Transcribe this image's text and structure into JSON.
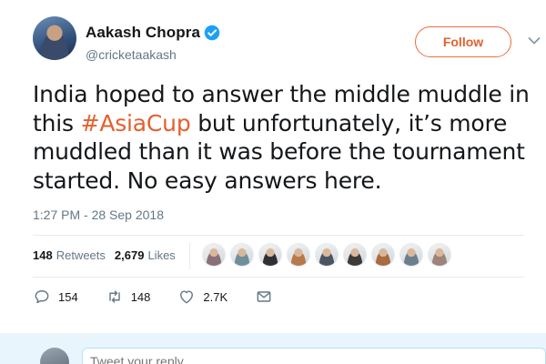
{
  "author": {
    "name": "Aakash Chopra",
    "handle": "@cricketaakash",
    "verified": true
  },
  "follow_label": "Follow",
  "tweet": {
    "lines": [
      [
        "India hoped to answer the middle muddle in"
      ],
      [
        "this ",
        "#AsiaCup",
        " but unfortunately, it’s more"
      ],
      [
        "muddled than it was before the tournament"
      ],
      [
        "started. No easy answers here."
      ]
    ],
    "hashtag": "#AsiaCup",
    "timestamp": "1:27 PM - 28 Sep 2018"
  },
  "stats": {
    "retweets_count": "148",
    "retweets_label": "Retweets",
    "likes_count": "2,679",
    "likes_label": "Likes"
  },
  "likers": [
    {
      "color": "#8a6f78"
    },
    {
      "color": "#6f8f9a"
    },
    {
      "color": "#2f2f34"
    },
    {
      "color": "#b87a4a"
    },
    {
      "color": "#4a5563"
    },
    {
      "color": "#3d3a38"
    },
    {
      "color": "#a86c3e"
    },
    {
      "color": "#6e7f8c"
    },
    {
      "color": "#9e8378"
    }
  ],
  "actions": {
    "reply_count": "154",
    "retweet_count": "148",
    "like_count": "2.7K"
  },
  "reply_placeholder": "Tweet your reply",
  "colors": {
    "accent": "#e3602e",
    "verified": "#1da1f2",
    "muted": "#657786"
  }
}
